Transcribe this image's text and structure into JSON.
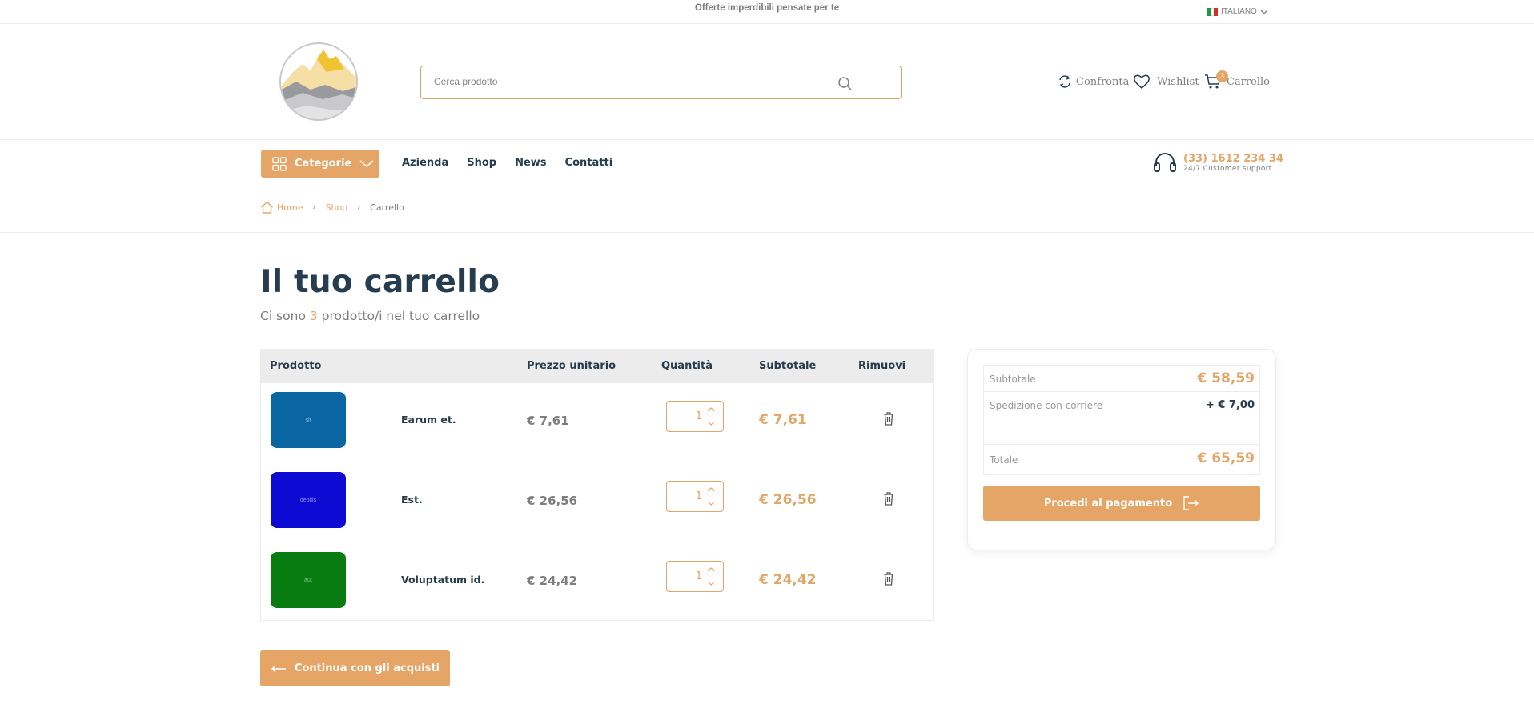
{
  "topbar": {
    "promo": "Offerte imperdibili pensate per te",
    "language": "ITALIANO"
  },
  "header": {
    "search_placeholder": "Cerca prodotto",
    "compare_label": "Confronta",
    "wishlist_label": "Wishlist",
    "cart_label": "Carrello",
    "cart_count": "3"
  },
  "nav": {
    "categories_label": "Categorie",
    "links": [
      "Azienda",
      "Shop",
      "News",
      "Contatti"
    ],
    "support_phone": "(33) 1612 234 34",
    "support_sub": "24/7 Customer support"
  },
  "breadcrumb": {
    "home": "Home",
    "shop": "Shop",
    "current": "Carrello"
  },
  "page": {
    "title": "Il tuo carrello",
    "subtitle_pre": "Ci sono ",
    "count": "3",
    "subtitle_post": " prodotto/i nel tuo carrello"
  },
  "table": {
    "headers": {
      "product": "Prodotto",
      "unit_price": "Prezzo unitario",
      "quantity": "Quantità",
      "subtotal": "Subtotale",
      "remove": "Rimuovi"
    },
    "rows": [
      {
        "thumb_text": "sit",
        "thumb_color": "#0a65a3",
        "name": "Earum et.",
        "unit_price": "€ 7,61",
        "qty": "1",
        "subtotal": "€ 7,61"
      },
      {
        "thumb_text": "debitis",
        "thumb_color": "#0d0ad3",
        "name": "Est.",
        "unit_price": "€ 26,56",
        "qty": "1",
        "subtotal": "€ 26,56"
      },
      {
        "thumb_text": "aut",
        "thumb_color": "#087c10",
        "name": "Voluptatum id.",
        "unit_price": "€ 24,42",
        "qty": "1",
        "subtotal": "€ 24,42"
      }
    ]
  },
  "summary": {
    "subtotal_label": "Subtotale",
    "subtotal_value": "€ 58,59",
    "shipping_label": "Spedizione con corriere",
    "shipping_value": "+ € 7,00",
    "total_label": "Totale",
    "total_value": "€ 65,59",
    "checkout_label": "Procedi al pagamento"
  },
  "continue_label": "Continua con gli acquisti",
  "colors": {
    "accent": "#e4a567",
    "heading": "#253d4e",
    "muted": "#7e7e7e"
  }
}
